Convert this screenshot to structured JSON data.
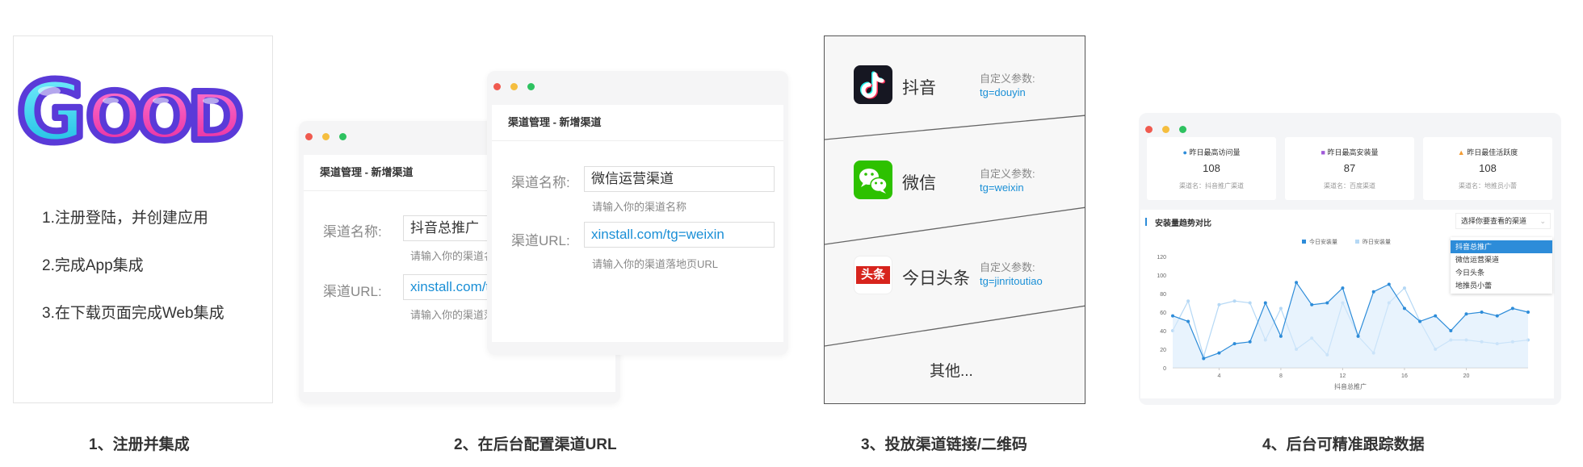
{
  "panel1": {
    "logo_text": "GOOD",
    "steps": [
      "1.注册登陆，并创建应用",
      "2.完成App集成",
      "3.在下载页面完成Web集成"
    ]
  },
  "panel2": {
    "back_window": {
      "title": "渠道管理 - 新增渠道",
      "name_label": "渠道名称:",
      "name_value": "抖音总推广",
      "name_hint": "请输入你的渠道名称",
      "url_label": "渠道URL:",
      "url_value": "xinstall.com/tg=douyin",
      "url_hint": "请输入你的渠道落地页URL"
    },
    "front_window": {
      "title": "渠道管理 - 新增渠道",
      "name_label": "渠道名称:",
      "name_value": "微信运营渠道",
      "name_hint": "请输入你的渠道名称",
      "url_label": "渠道URL:",
      "url_value": "xinstall.com/tg=weixin",
      "url_hint": "请输入你的渠道落地页URL"
    }
  },
  "panel3": {
    "channels": [
      {
        "name": "抖音",
        "param_label": "自定义参数:",
        "param_value": "tg=douyin",
        "icon": "douyin-icon"
      },
      {
        "name": "微信",
        "param_label": "自定义参数:",
        "param_value": "tg=weixin",
        "icon": "wechat-icon"
      },
      {
        "name": "今日头条",
        "param_label": "自定义参数:",
        "param_value": "tg=jinritoutiao",
        "icon": "toutiao-icon",
        "icon_text": "头条"
      }
    ],
    "other": "其他..."
  },
  "panel4": {
    "stats": [
      {
        "title": "昨日最高访问量",
        "value": "108",
        "sub": "渠道名：抖音推广渠道"
      },
      {
        "title": "昨日最高安装量",
        "value": "87",
        "sub": "渠道名：百度渠道"
      },
      {
        "title": "昨日最佳活跃度",
        "value": "108",
        "sub": "渠道名：地推员小蕾"
      }
    ],
    "chart_title": "安装量趋势对比",
    "select_placeholder": "选择你要查看的渠道",
    "dropdown_options": [
      "抖音总推广",
      "微信运营渠道",
      "今日头条",
      "地推员小蕾"
    ],
    "selected_option": "抖音总推广"
  },
  "chart_data": {
    "type": "line",
    "title": "安装量趋势对比",
    "xlabel": "抖音总推广",
    "ylabel": "",
    "ylim": [
      0,
      120
    ],
    "yticks": [
      0,
      20,
      40,
      60,
      80,
      100,
      120
    ],
    "xticks": [
      4,
      8,
      12,
      16,
      20
    ],
    "x": [
      1,
      2,
      3,
      4,
      5,
      6,
      7,
      8,
      9,
      10,
      11,
      12,
      13,
      14,
      15,
      16,
      17,
      18,
      19,
      20,
      21,
      22,
      23,
      24
    ],
    "series": [
      {
        "name": "今日安装量",
        "color": "#2d8cd9",
        "values": [
          56,
          50,
          10,
          16,
          26,
          28,
          70,
          34,
          92,
          68,
          70,
          86,
          34,
          82,
          90,
          64,
          50,
          56,
          40,
          58,
          60,
          56,
          64,
          60
        ]
      },
      {
        "name": "昨日安装量",
        "color": "#b5d8f5",
        "values": [
          40,
          72,
          12,
          68,
          72,
          70,
          30,
          64,
          20,
          32,
          14,
          70,
          34,
          16,
          70,
          86,
          50,
          20,
          30,
          30,
          28,
          26,
          28,
          30
        ]
      }
    ],
    "legend": "top-center",
    "grid": false
  },
  "captions": [
    "1、注册并集成",
    "2、在后台配置渠道URL",
    "3、投放渠道链接/二维码",
    "4、后台可精准跟踪数据"
  ],
  "colors": {
    "dot_red": "#f05a4f",
    "dot_yellow": "#f5be3f",
    "dot_green": "#2ec260",
    "link_blue": "#1a8fd6"
  }
}
